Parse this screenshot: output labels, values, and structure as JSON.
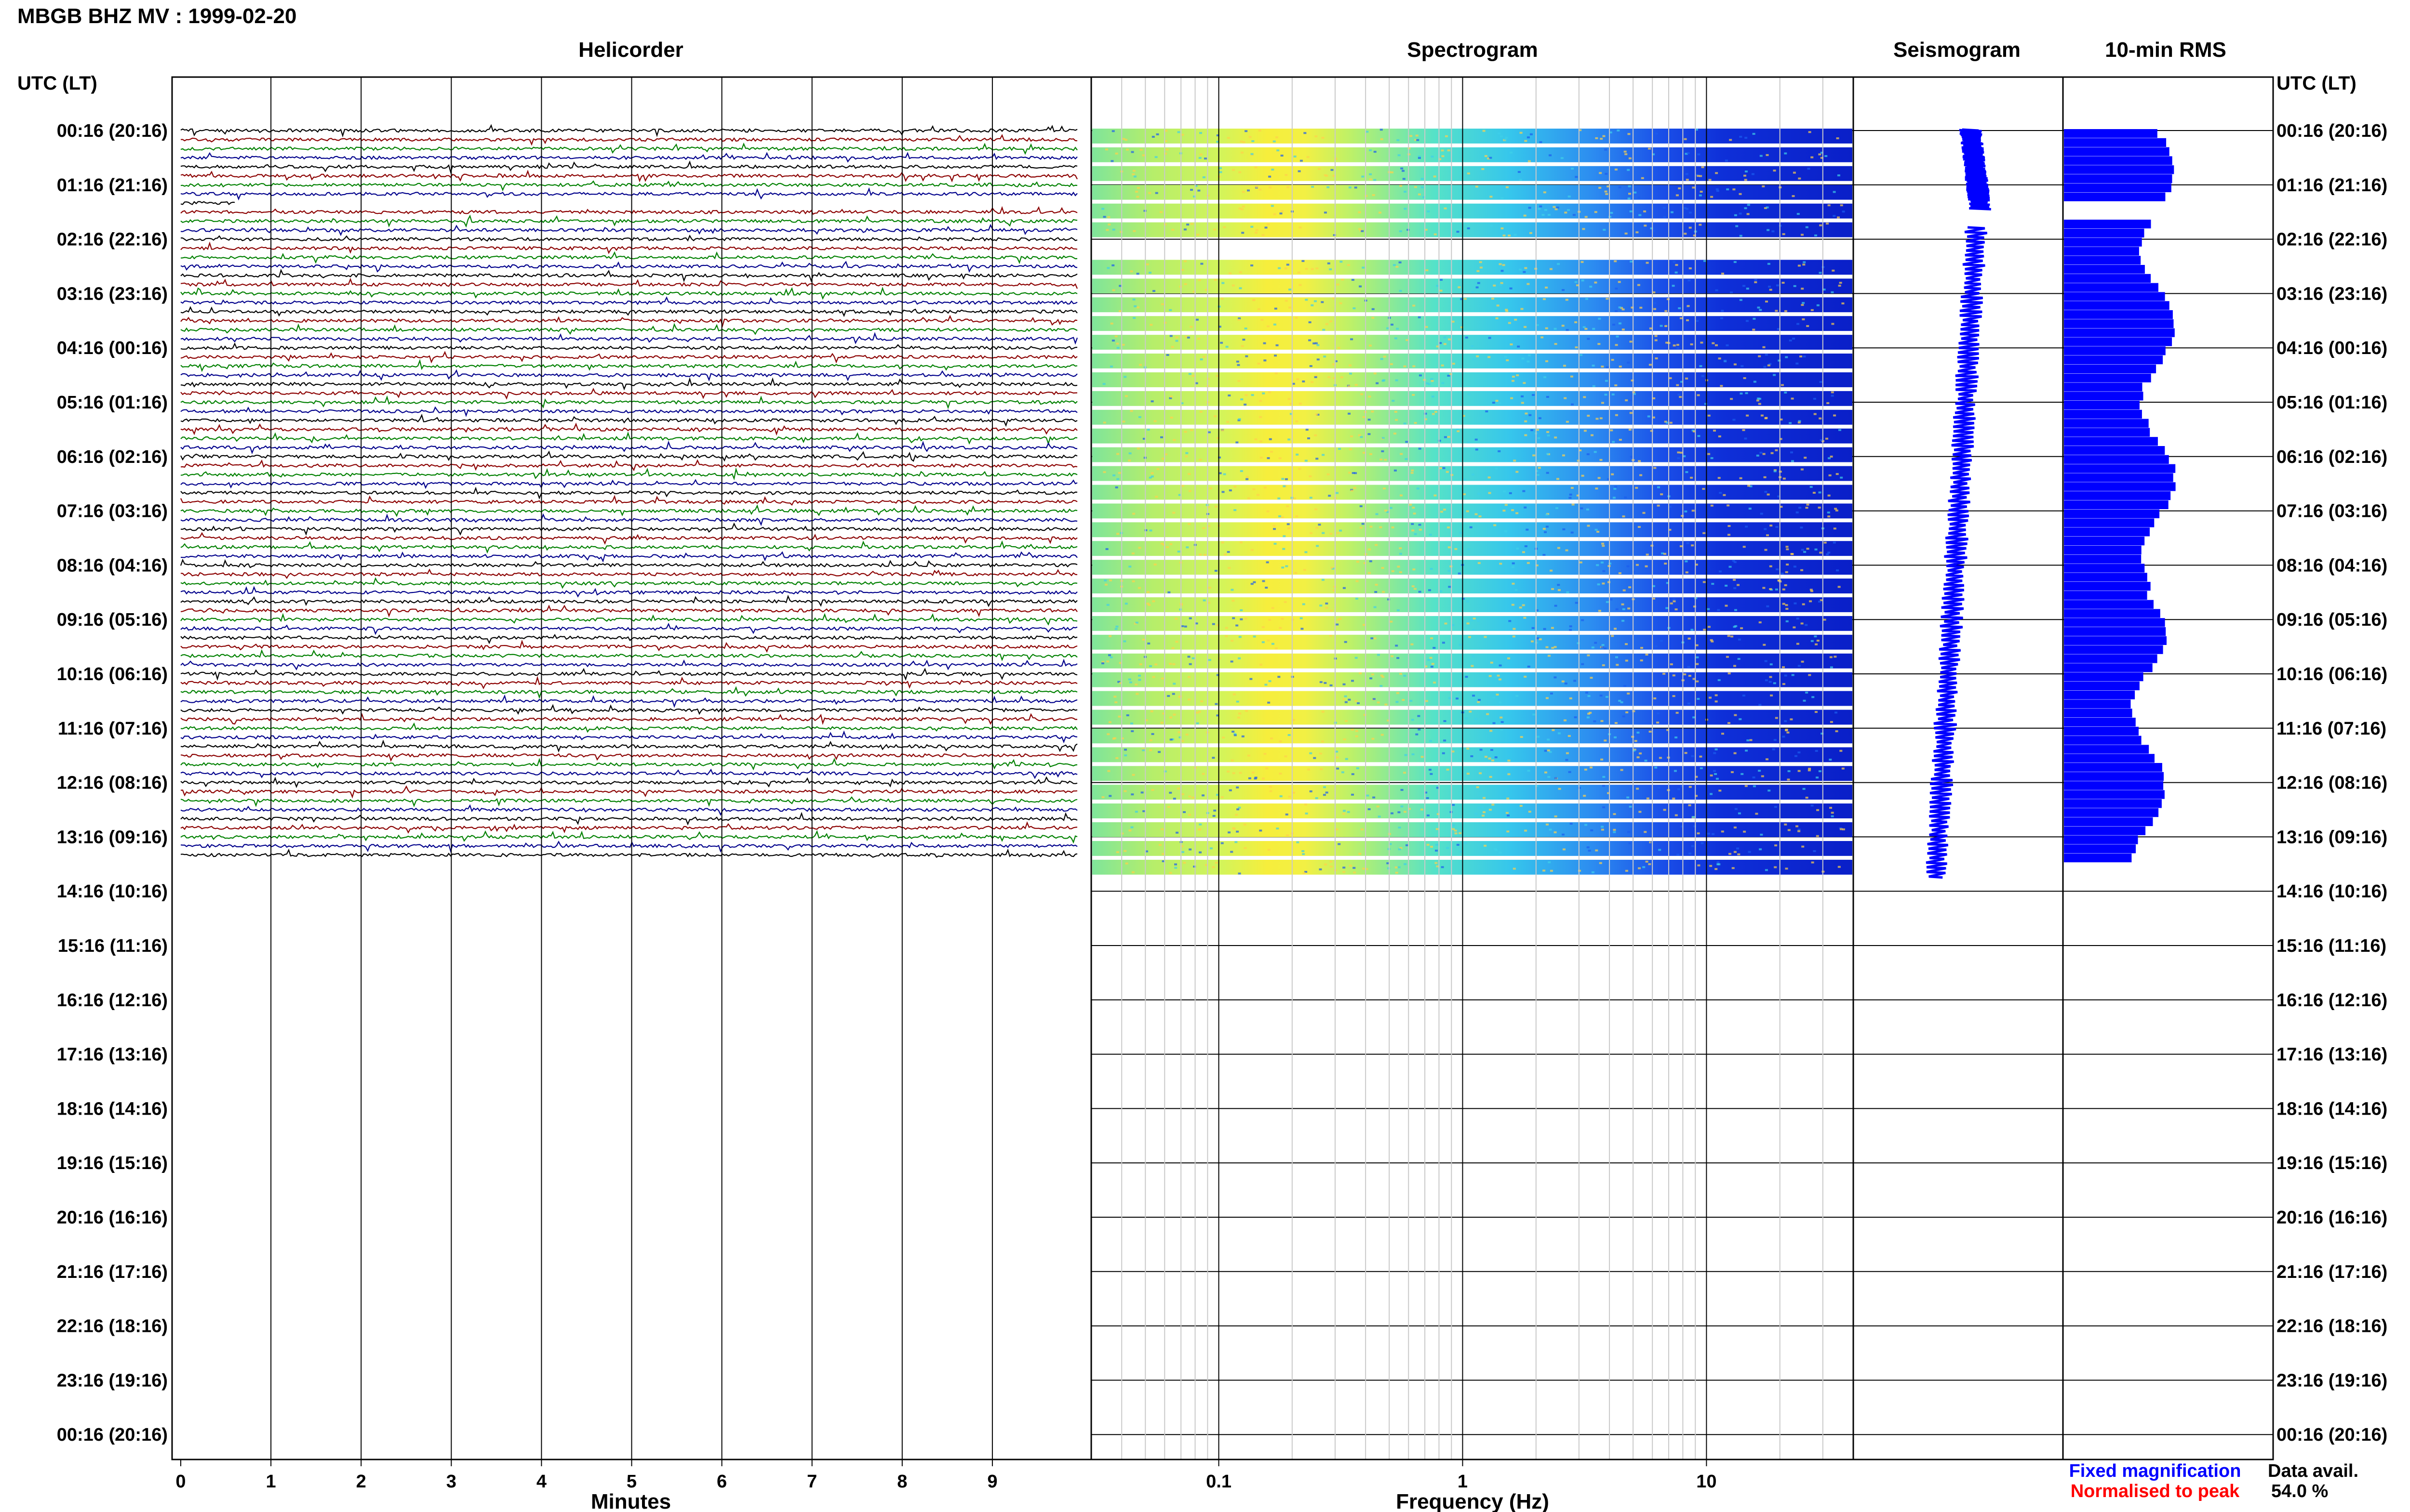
{
  "title": "MBGB BHZ MV : 1999-02-20",
  "panels": {
    "helicorder": "Helicorder",
    "spectrogram": "Spectrogram",
    "seismogram": "Seismogram",
    "rms": "10-min RMS"
  },
  "row_axis_label": "UTC (LT)",
  "hour_labels": [
    "00:16 (20:16)",
    "01:16 (21:16)",
    "02:16 (22:16)",
    "03:16 (23:16)",
    "04:16 (00:16)",
    "05:16 (01:16)",
    "06:16 (02:16)",
    "07:16 (03:16)",
    "08:16 (04:16)",
    "09:16 (05:16)",
    "10:16 (06:16)",
    "11:16 (07:16)",
    "12:16 (08:16)",
    "13:16 (09:16)",
    "14:16 (10:16)",
    "15:16 (11:16)",
    "16:16 (12:16)",
    "17:16 (13:16)",
    "18:16 (14:16)",
    "19:16 (15:16)",
    "20:16 (16:16)",
    "21:16 (17:16)",
    "22:16 (18:16)",
    "23:16 (19:16)",
    "00:16 (20:16)"
  ],
  "legend": {
    "fixed": "Fixed magnification",
    "normalised": "Normalised to peak",
    "fixed_color": "#0000ff",
    "normalised_color": "#ff0000"
  },
  "availability": {
    "label": "Data avail.",
    "value": "54.0 %"
  },
  "colors": {
    "trace_cycle": [
      "#000000",
      "#8b0000",
      "#008000",
      "#00008b"
    ],
    "seismogram": "#0000ff",
    "rms": "#0000ff",
    "grid": "#000000"
  },
  "chart_data": [
    {
      "type": "line",
      "panel": "Helicorder",
      "xlabel": "Minutes",
      "x_ticks": [
        "0",
        "1",
        "2",
        "3",
        "4",
        "5",
        "6",
        "7",
        "8",
        "9"
      ],
      "xlim": [
        0,
        10
      ],
      "rows_per_hour": 6,
      "data_hours": 13.5,
      "gap_after_hour": 1.5
    },
    {
      "type": "heatmap",
      "panel": "Spectrogram",
      "xlabel": "Frequency (Hz)",
      "x_scale": "log",
      "x_ticks": [
        "0.1",
        "1",
        "10"
      ],
      "xlim": [
        0.03,
        40
      ],
      "data_hours": 13.5
    },
    {
      "type": "line",
      "panel": "Seismogram",
      "data_hours": 13.5,
      "gap_after_hour": 1.5
    },
    {
      "type": "bar",
      "panel": "10-min RMS",
      "data_hours": 13.5,
      "gap_after_hour": 1.5
    }
  ]
}
